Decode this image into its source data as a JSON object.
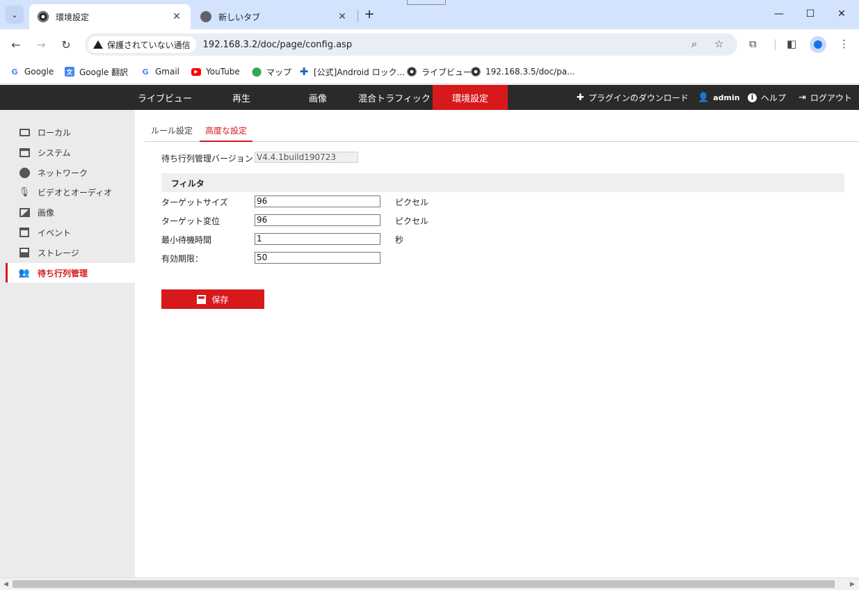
{
  "browser": {
    "tabs": [
      {
        "title": "環境設定",
        "icon": "camera-favicon",
        "active": true
      },
      {
        "title": "新しいタブ",
        "icon": "globe-favicon",
        "active": false
      }
    ],
    "new_tab_label": "+",
    "address": {
      "security_label": "保護されていない通信",
      "url": "192.168.3.2/doc/page/config.asp"
    },
    "bookmarks": [
      {
        "label": "Google",
        "icon": "google-icon"
      },
      {
        "label": "Google 翻訳",
        "icon": "translate-icon"
      },
      {
        "label": "Gmail",
        "icon": "google-icon"
      },
      {
        "label": "YouTube",
        "icon": "youtube-icon"
      },
      {
        "label": "マップ",
        "icon": "maps-pin-icon"
      },
      {
        "label": "[公式]Android ロック...",
        "icon": "plus-cross-icon"
      },
      {
        "label": "ライブビュー",
        "icon": "camera-favicon"
      },
      {
        "label": "192.168.3.5/doc/pa...",
        "icon": "camera-favicon"
      }
    ]
  },
  "app": {
    "nav": [
      {
        "label": "ライブビュー",
        "active": false
      },
      {
        "label": "再生",
        "active": false
      },
      {
        "label": "画像",
        "active": false
      },
      {
        "label": "混合トラフィック",
        "active": false
      },
      {
        "label": "環境設定",
        "active": true
      }
    ],
    "header_right": {
      "plugin_download": "プラグインのダウンロード",
      "user": "admin",
      "help": "ヘルプ",
      "logout": "ログアウト"
    },
    "colors": {
      "accent": "#d7191c",
      "header_bg": "#2a2a2a",
      "sidebar_bg": "#ebebeb"
    }
  },
  "sidebar": {
    "items": [
      {
        "label": "ローカル",
        "icon": "monitor-icon",
        "active": false
      },
      {
        "label": "システム",
        "icon": "window-icon",
        "active": false
      },
      {
        "label": "ネットワーク",
        "icon": "globe-icon",
        "active": false
      },
      {
        "label": "ビデオとオーディオ",
        "icon": "mic-icon",
        "active": false
      },
      {
        "label": "画像",
        "icon": "image-icon",
        "active": false
      },
      {
        "label": "イベント",
        "icon": "calendar-icon",
        "active": false
      },
      {
        "label": "ストレージ",
        "icon": "floppy-icon",
        "active": false
      },
      {
        "label": "待ち行列管理",
        "icon": "people-icon",
        "active": true
      }
    ]
  },
  "main": {
    "subtabs": [
      {
        "label": "ルール設定",
        "active": false
      },
      {
        "label": "高度な設定",
        "active": true
      }
    ],
    "version": {
      "label": "待ち行列管理バージョン",
      "value": "V4.4.1build190723"
    },
    "filter_section": "フィルタ",
    "fields": [
      {
        "label": "ターゲットサイズ",
        "value": "96",
        "unit": "ピクセル"
      },
      {
        "label": "ターゲット変位",
        "value": "96",
        "unit": "ピクセル"
      },
      {
        "label": "最小待機時間",
        "value": "1",
        "unit": "秒"
      },
      {
        "label": "有効期限：",
        "value": "50",
        "unit": ""
      }
    ],
    "save_label": "保存"
  }
}
